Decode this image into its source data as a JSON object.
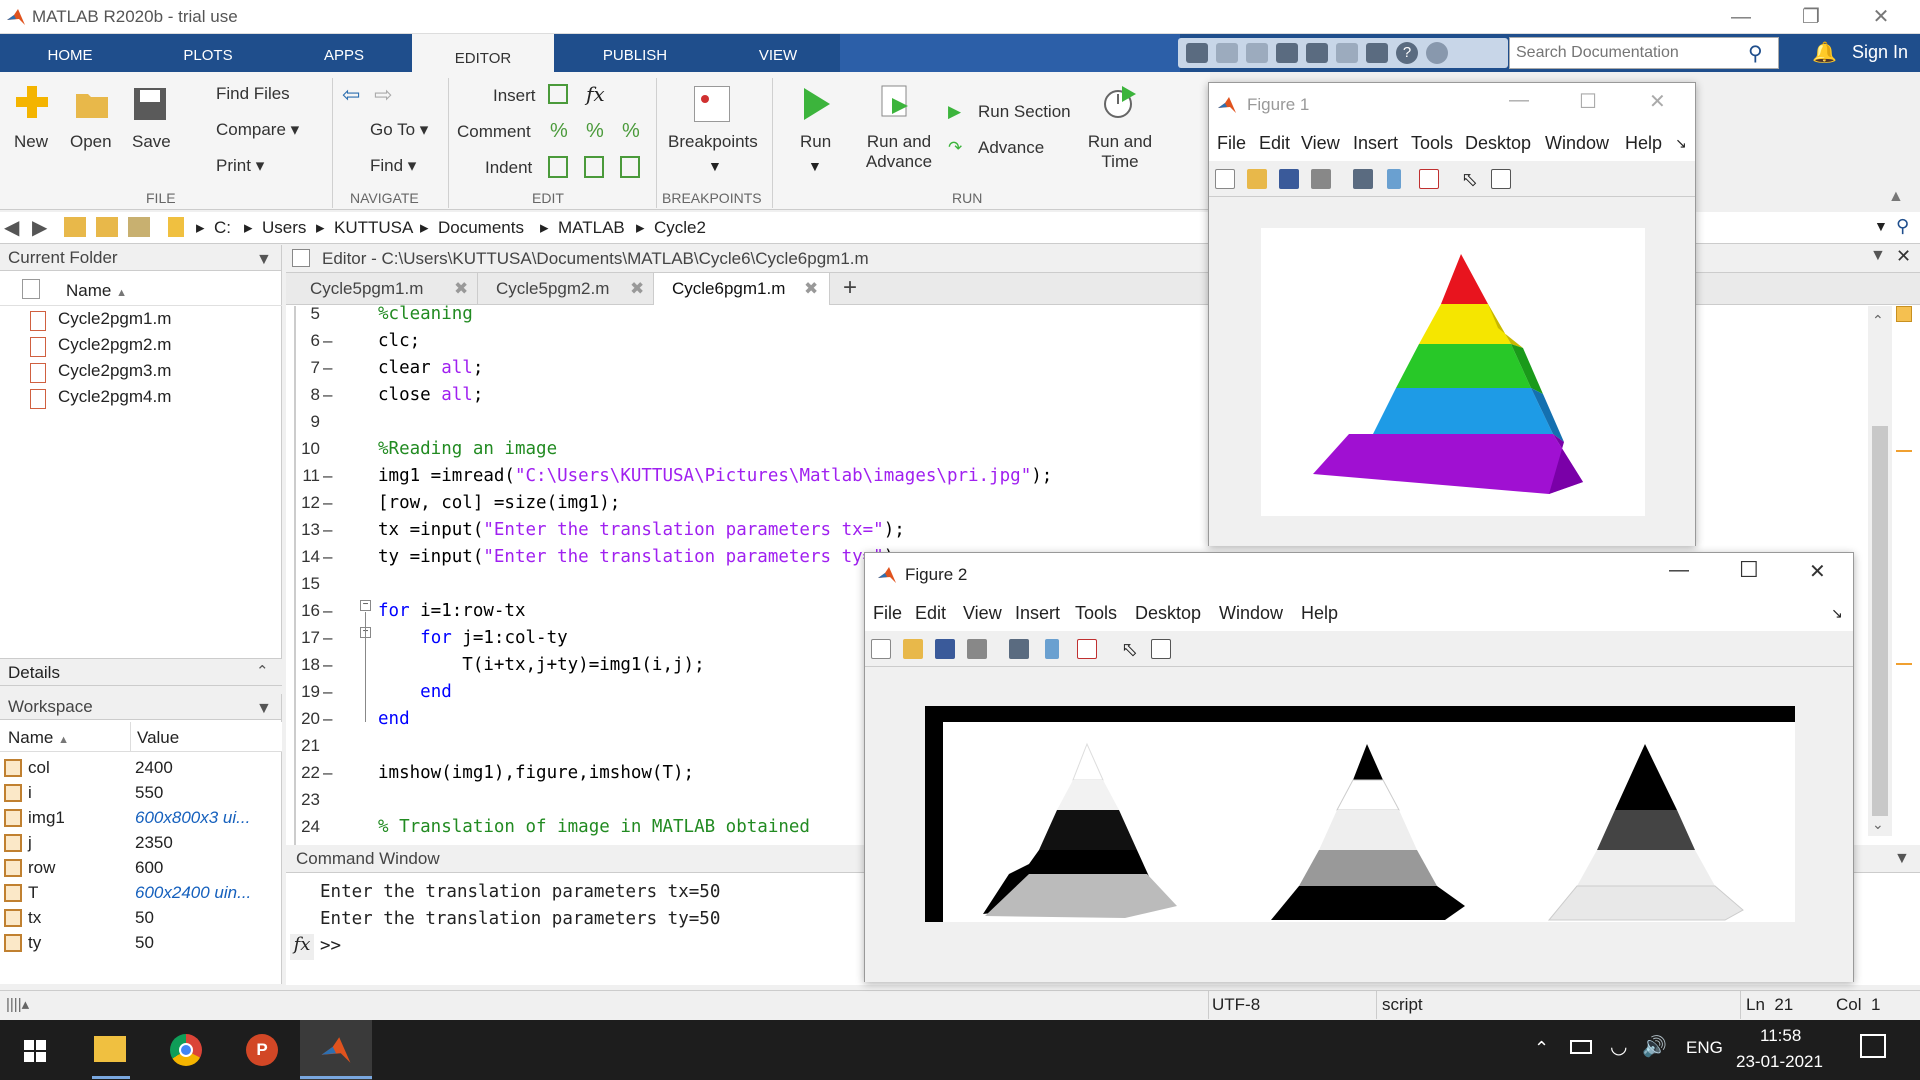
{
  "window": {
    "title": "MATLAB R2020b - trial use"
  },
  "ribbon_tabs": [
    "HOME",
    "PLOTS",
    "APPS",
    "EDITOR",
    "PUBLISH",
    "VIEW"
  ],
  "search": {
    "placeholder": "Search Documentation"
  },
  "signin": "Sign In",
  "ribbon": {
    "file": {
      "new": "New",
      "open": "Open",
      "save": "Save",
      "find_files": "Find Files",
      "compare": "Compare",
      "print": "Print",
      "group": "FILE"
    },
    "navigate": {
      "goto": "Go To",
      "find": "Find",
      "group": "NAVIGATE"
    },
    "edit": {
      "insert": "Insert",
      "comment": "Comment",
      "indent": "Indent",
      "group": "EDIT"
    },
    "breakpoints": {
      "label": "Breakpoints",
      "group": "BREAKPOINTS"
    },
    "run": {
      "run": "Run",
      "run_advance_1": "Run and",
      "run_advance_2": "Advance",
      "run_section": "Run Section",
      "advance": "Advance",
      "run_time_1": "Run and",
      "run_time_2": "Time",
      "group": "RUN"
    }
  },
  "address": [
    "C:",
    "Users",
    "KUTTUSA",
    "Documents",
    "MATLAB",
    "Cycle2"
  ],
  "current_folder": {
    "title": "Current Folder",
    "col_name": "Name",
    "files": [
      "Cycle2pgm1.m",
      "Cycle2pgm2.m",
      "Cycle2pgm3.m",
      "Cycle2pgm4.m"
    ]
  },
  "details": {
    "title": "Details"
  },
  "workspace": {
    "title": "Workspace",
    "col_name": "Name",
    "col_value": "Value",
    "rows": [
      {
        "name": "col",
        "value": "2400"
      },
      {
        "name": "i",
        "value": "550"
      },
      {
        "name": "img1",
        "value": "600x800x3 ui..."
      },
      {
        "name": "j",
        "value": "2350"
      },
      {
        "name": "row",
        "value": "600"
      },
      {
        "name": "T",
        "value": "600x2400 uin..."
      },
      {
        "name": "tx",
        "value": "50"
      },
      {
        "name": "ty",
        "value": "50"
      }
    ]
  },
  "editor": {
    "title": "Editor - C:\\Users\\KUTTUSA\\Documents\\MATLAB\\Cycle6\\Cycle6pgm1.m",
    "tabs": [
      "Cycle5pgm1.m",
      "Cycle5pgm2.m",
      "Cycle6pgm1.m"
    ],
    "lines": [
      {
        "n": "5",
        "dash": "",
        "text": "%cleaning"
      },
      {
        "n": "6",
        "dash": "–",
        "text": "clc;"
      },
      {
        "n": "7",
        "dash": "–",
        "text": "clear all;"
      },
      {
        "n": "8",
        "dash": "–",
        "text": "close all;"
      },
      {
        "n": "9",
        "dash": "",
        "text": ""
      },
      {
        "n": "10",
        "dash": "",
        "text": "%Reading an image"
      },
      {
        "n": "11",
        "dash": "–",
        "text": "img1 =imread(\"C:\\Users\\KUTTUSA\\Pictures\\Matlab\\images\\pri.jpg\");"
      },
      {
        "n": "12",
        "dash": "–",
        "text": "[row, col] =size(img1);"
      },
      {
        "n": "13",
        "dash": "–",
        "text": "tx =input(\"Enter the translation parameters tx=\");"
      },
      {
        "n": "14",
        "dash": "–",
        "text": "ty =input(\"Enter the translation parameters ty=\");"
      },
      {
        "n": "15",
        "dash": "",
        "text": ""
      },
      {
        "n": "16",
        "dash": "–",
        "text": "for i=1:row-tx"
      },
      {
        "n": "17",
        "dash": "–",
        "text": "    for j=1:col-ty"
      },
      {
        "n": "18",
        "dash": "–",
        "text": "        T(i+tx,j+ty)=img1(i,j);"
      },
      {
        "n": "19",
        "dash": "–",
        "text": "    end"
      },
      {
        "n": "20",
        "dash": "–",
        "text": "end"
      },
      {
        "n": "21",
        "dash": "",
        "text": ""
      },
      {
        "n": "22",
        "dash": "–",
        "text": "imshow(img1),figure,imshow(T);"
      },
      {
        "n": "23",
        "dash": "",
        "text": ""
      },
      {
        "n": "24",
        "dash": "",
        "text": "% Translation of image in MATLAB obtained"
      }
    ]
  },
  "command_window": {
    "title": "Command Window",
    "lines": [
      "Enter the translation parameters tx=50",
      "Enter the translation parameters ty=50"
    ],
    "prompt": ">>"
  },
  "status": {
    "encoding": "UTF-8",
    "type": "script",
    "ln": "Ln  21",
    "col": "Col  1"
  },
  "figure1": {
    "title": "Figure 1",
    "menu": [
      "File",
      "Edit",
      "View",
      "Insert",
      "Tools",
      "Desktop",
      "Window",
      "Help"
    ]
  },
  "figure2": {
    "title": "Figure 2",
    "menu": [
      "File",
      "Edit",
      "View",
      "Insert",
      "Tools",
      "Desktop",
      "Window",
      "Help"
    ]
  },
  "taskbar": {
    "lang": "ENG",
    "time": "11:58",
    "date": "23-01-2021"
  },
  "colors": {
    "ribbon_blue": "#1f4e8c",
    "pyramid": [
      "#e8141e",
      "#f5e600",
      "#28c828",
      "#1e9be6",
      "#a010d2"
    ]
  }
}
